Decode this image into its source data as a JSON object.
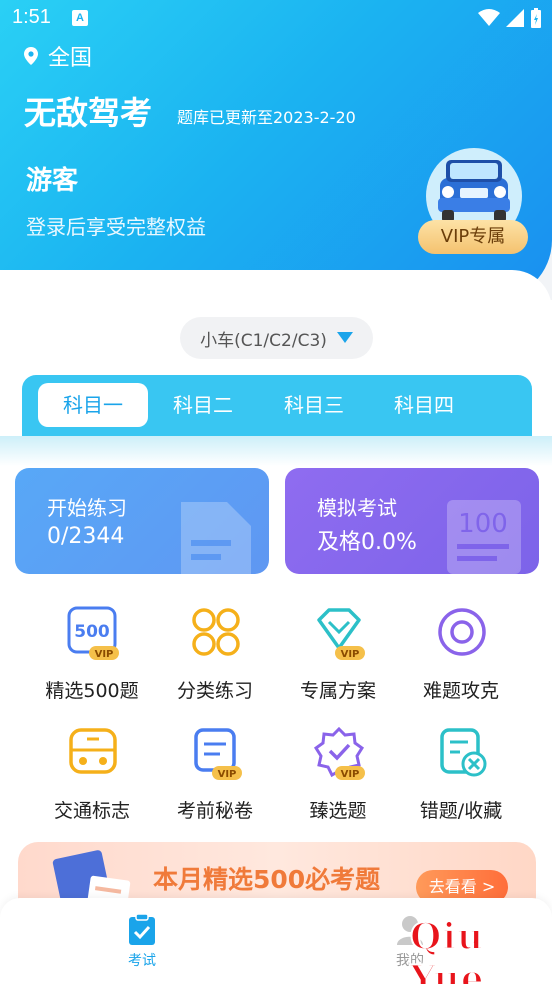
{
  "status_bar": {
    "time": "1:51",
    "notification_letter": "A"
  },
  "header": {
    "location": "全国",
    "app_name": "无敌驾考",
    "update_note": "题库已更新至2023-2-20",
    "user_name": "游客",
    "login_hint": "登录后享受完整权益",
    "vip_label": "VIP专属"
  },
  "car_type": {
    "selected": "小车(C1/C2/C3)"
  },
  "subjects": {
    "tabs": [
      "科目一",
      "科目二",
      "科目三",
      "科目四"
    ],
    "active_index": 0
  },
  "cards": {
    "practice": {
      "title": "开始练习",
      "value": "0/2344",
      "deco_icon": "document-icon"
    },
    "exam": {
      "title": "模拟考试",
      "value": "及格0.0%",
      "deco_icon": "score-100-icon"
    }
  },
  "features": [
    {
      "label": "精选500题",
      "icon": "500-vip-icon"
    },
    {
      "label": "分类练习",
      "icon": "category-icon"
    },
    {
      "label": "专属方案",
      "icon": "diamond-vip-icon"
    },
    {
      "label": "难题攻克",
      "icon": "target-icon"
    },
    {
      "label": "交通标志",
      "icon": "bus-icon"
    },
    {
      "label": "考前秘卷",
      "icon": "exam-paper-vip-icon"
    },
    {
      "label": "臻选题",
      "icon": "badge-check-vip-icon"
    },
    {
      "label": "错题/收藏",
      "icon": "wrong-question-icon"
    }
  ],
  "vip_badge": "VIP",
  "score_badge": "100",
  "promo": {
    "text": "本月精选500必考题",
    "button": "去看看 >"
  },
  "bottom_tabs": {
    "exam": "考试",
    "me": "我的"
  },
  "watermark": "Qiu Yue",
  "colors": {
    "primary": "#1aa4ea",
    "accent": "#f07a3a",
    "vip_gold": "#f4c26f"
  }
}
